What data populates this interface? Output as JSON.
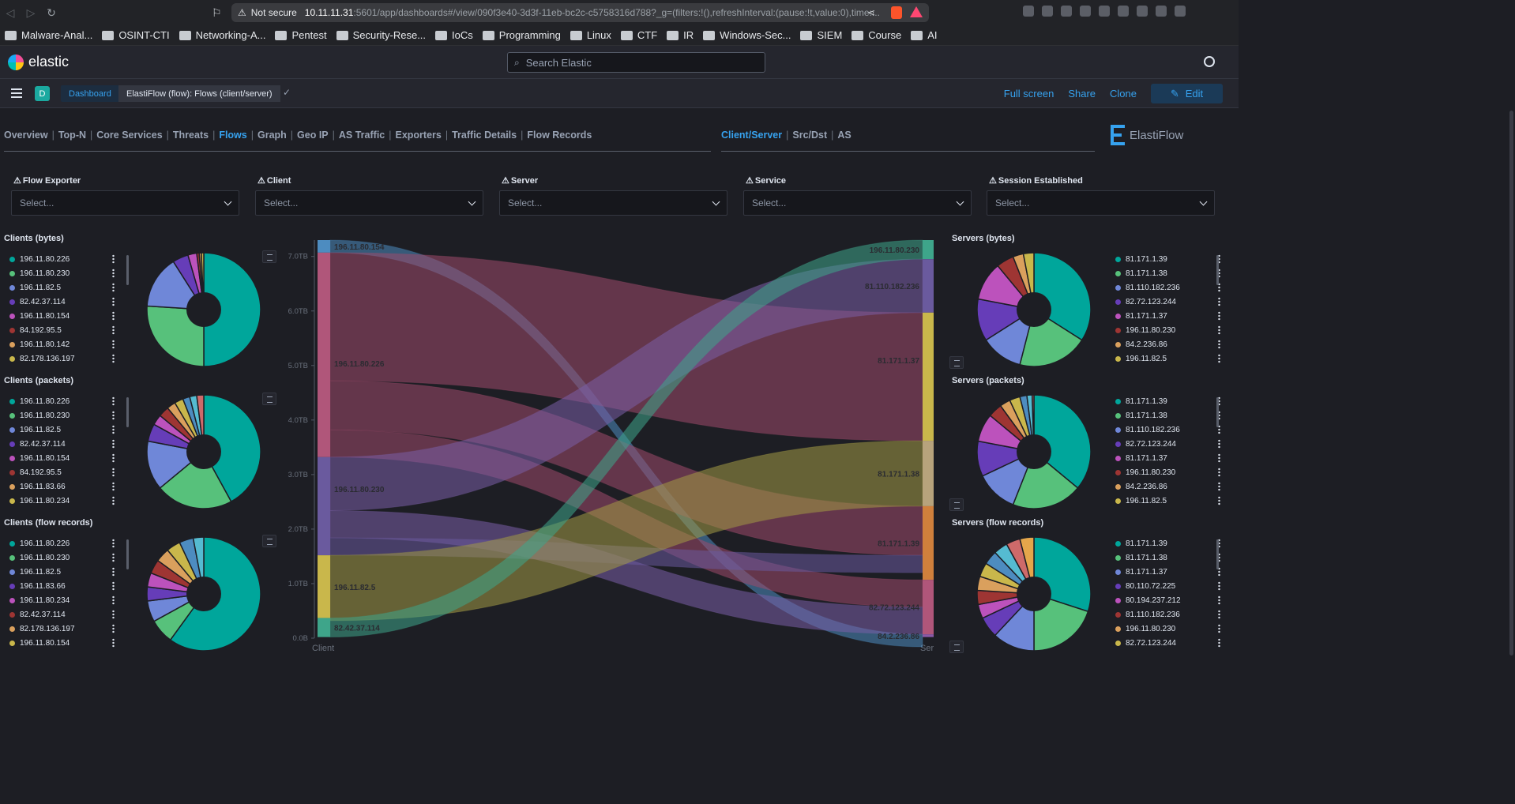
{
  "browser": {
    "security_label": "Not secure",
    "url_host": "10.11.11.31",
    "url_path": ":5601/app/dashboards#/view/090f3e40-3d3f-11eb-bc2c-c5758316d788?_g=(filters:!(),refreshInterval:(pause:!t,value:0),time:...",
    "bookmarks": [
      "Malware-Anal...",
      "OSINT-CTI",
      "Networking-A...",
      "Pentest",
      "Security-Rese...",
      "IoCs",
      "Programming",
      "Linux",
      "CTF",
      "IR",
      "Windows-Sec...",
      "SIEM",
      "Course",
      "AI"
    ]
  },
  "header": {
    "logo": "elastic",
    "search_placeholder": "Search Elastic",
    "space_initial": "D",
    "breadcrumb_root": "Dashboard",
    "breadcrumb_current": "ElastiFlow (flow): Flows (client/server)",
    "actions": {
      "full_screen": "Full screen",
      "share": "Share",
      "clone": "Clone",
      "edit": "Edit"
    }
  },
  "nav_tabs": [
    "Overview",
    "Top-N",
    "Core Services",
    "Threats",
    "Flows",
    "Graph",
    "Geo IP",
    "AS Traffic",
    "Exporters",
    "Traffic Details",
    "Flow Records"
  ],
  "nav_active": "Flows",
  "sub_tabs": [
    "Client/Server",
    "Src/Dst",
    "AS"
  ],
  "sub_active": "Client/Server",
  "brand": "ElastiFlow",
  "controls": [
    {
      "label": "Flow Exporter",
      "placeholder": "Select..."
    },
    {
      "label": "Client",
      "placeholder": "Select..."
    },
    {
      "label": "Server",
      "placeholder": "Select..."
    },
    {
      "label": "Service",
      "placeholder": "Select..."
    },
    {
      "label": "Session Established",
      "placeholder": "Select..."
    }
  ],
  "colors": [
    "#00a69b",
    "#57c17b",
    "#6f87d8",
    "#663db8",
    "#bc52bc",
    "#9e3533",
    "#daa05d",
    "#c9b74b",
    "#4d8cc0",
    "#55bbd1"
  ],
  "pies": {
    "clients_bytes": {
      "title": "Clients (bytes)",
      "legend": [
        "196.11.80.226",
        "196.11.80.230",
        "196.11.82.5",
        "82.42.37.114",
        "196.11.80.154",
        "84.192.95.5",
        "196.11.80.142",
        "82.178.136.197"
      ],
      "values": [
        50,
        26,
        15,
        4.5,
        2.5,
        0.7,
        0.6,
        0.7
      ]
    },
    "clients_packets": {
      "title": "Clients (packets)",
      "legend": [
        "196.11.80.226",
        "196.11.80.230",
        "196.11.82.5",
        "82.42.37.114",
        "196.11.80.154",
        "84.192.95.5",
        "196.11.83.66",
        "196.11.80.234"
      ],
      "values": [
        42,
        22,
        14,
        5,
        3,
        3,
        2.5,
        2.5,
        2,
        2,
        2
      ]
    },
    "clients_flows": {
      "title": "Clients (flow records)",
      "legend": [
        "196.11.80.226",
        "196.11.80.230",
        "196.11.82.5",
        "196.11.83.66",
        "196.11.80.234",
        "82.42.37.114",
        "82.178.136.197",
        "196.11.80.154"
      ],
      "values": [
        60,
        7,
        6,
        4,
        4,
        4,
        4,
        4,
        4,
        3
      ]
    },
    "servers_bytes": {
      "title": "Servers (bytes)",
      "legend": [
        "81.171.1.39",
        "81.171.1.38",
        "81.110.182.236",
        "82.72.123.244",
        "81.171.1.37",
        "196.11.80.230",
        "84.2.236.86",
        "196.11.82.5"
      ],
      "values": [
        34,
        20,
        12,
        12,
        11,
        5,
        3,
        3
      ]
    },
    "servers_packets": {
      "title": "Servers (packets)",
      "legend": [
        "81.171.1.39",
        "81.171.1.38",
        "81.110.182.236",
        "82.72.123.244",
        "81.171.1.37",
        "196.11.80.230",
        "84.2.236.86",
        "196.11.82.5"
      ],
      "values": [
        36,
        20,
        12,
        10,
        8,
        4,
        3,
        3,
        2,
        1.5,
        0.5
      ]
    },
    "servers_flows": {
      "title": "Servers (flow records)",
      "legend": [
        "81.171.1.39",
        "81.171.1.38",
        "81.171.1.37",
        "80.110.72.225",
        "80.194.237.212",
        "81.110.182.236",
        "196.11.80.230",
        "82.72.123.244"
      ],
      "values": [
        30,
        20,
        12,
        6,
        4,
        4,
        4,
        4,
        4,
        4,
        4,
        4
      ]
    }
  },
  "chart_data": {
    "type": "sankey",
    "y_ticks": [
      "0.0B",
      "1.0TB",
      "2.0TB",
      "3.0TB",
      "4.0TB",
      "5.0TB",
      "6.0TB",
      "7.0TB"
    ],
    "x_labels": [
      "Client",
      "Ser"
    ],
    "clients": [
      {
        "name": "196.11.80.154",
        "value": 0.23
      },
      {
        "name": "196.11.80.226",
        "value": 3.75
      },
      {
        "name": "196.11.80.230",
        "value": 1.8
      },
      {
        "name": "196.11.82.5",
        "value": 1.15
      },
      {
        "name": "82.42.37.114",
        "value": 0.35
      }
    ],
    "servers": [
      {
        "name": "196.11.80.230",
        "value": 0.35
      },
      {
        "name": "81.110.182.236",
        "value": 0.98
      },
      {
        "name": "81.171.1.37",
        "value": 2.35
      },
      {
        "name": "81.171.1.38",
        "value": 1.2
      },
      {
        "name": "81.171.1.39",
        "value": 1.35
      },
      {
        "name": "82.72.123.244",
        "value": 1.0
      },
      {
        "name": "84.2.236.86",
        "value": 0.05
      }
    ]
  }
}
